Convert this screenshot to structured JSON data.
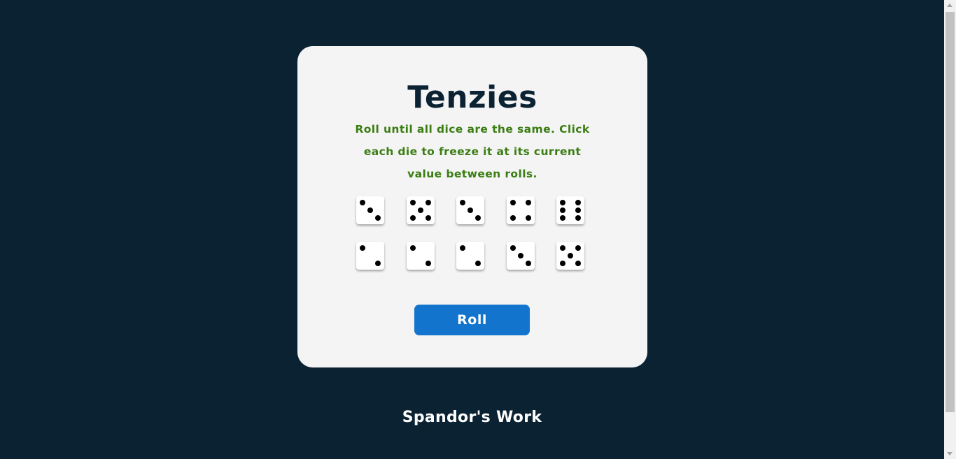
{
  "title": "Tenzies",
  "instructions": "Roll until all dice are the same. Click each die to freeze it at its current value between rolls.",
  "dice": [
    {
      "value": 3,
      "held": false
    },
    {
      "value": 5,
      "held": false
    },
    {
      "value": 3,
      "held": false
    },
    {
      "value": 4,
      "held": false
    },
    {
      "value": 6,
      "held": false
    },
    {
      "value": 2,
      "held": false
    },
    {
      "value": 2,
      "held": false
    },
    {
      "value": 2,
      "held": false
    },
    {
      "value": 3,
      "held": false
    },
    {
      "value": 5,
      "held": false
    }
  ],
  "roll_button_label": "Roll",
  "footer": "Spandor's Work",
  "colors": {
    "background": "#0b2233",
    "card": "#f4f4f4",
    "title": "#0b2233",
    "instructions": "#3a7d12",
    "button": "#1274cc",
    "pip": "#000000"
  }
}
